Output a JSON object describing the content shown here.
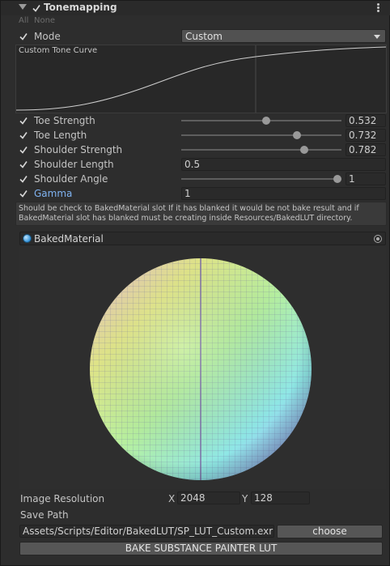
{
  "header": {
    "title": "Tonemapping",
    "all": "All",
    "none": "None"
  },
  "mode": {
    "label": "Mode",
    "value": "Custom"
  },
  "curve": {
    "title": "Custom Tone Curve"
  },
  "params": [
    {
      "label": "Toe Strength",
      "value": "0.532",
      "slider": 0.532
    },
    {
      "label": "Toe Length",
      "value": "0.732",
      "slider": 0.732
    },
    {
      "label": "Shoulder Strength",
      "value": "0.782",
      "slider": 0.782
    },
    {
      "label": "Shoulder Length",
      "value": "0.5"
    },
    {
      "label": "Shoulder Angle",
      "value": "1",
      "slider": 1.0
    },
    {
      "label": "Gamma",
      "value": "1"
    }
  ],
  "help": {
    "line1": "Should be check to BakedMaterial slot If it has blanked it would be not bake result and if",
    "line2": "BakedMaterial slot has blanked must be creating inside Resources/BakedLUT directory."
  },
  "baked_material": {
    "name": "BakedMaterial"
  },
  "resolution": {
    "label": "Image Resolution",
    "x_label": "X",
    "x_value": "2048",
    "y_label": "Y",
    "y_value": "128"
  },
  "save_path": {
    "label": "Save Path",
    "value": "Assets/Scripts/Editor/BakedLUT/SP_LUT_Custom.exr",
    "choose": "choose"
  },
  "bake_button": "BAKE SUBSTANCE PAINTER LUT",
  "colors": {
    "accent_blue": "#7fb2f0",
    "bg": "#2d2d2d",
    "field": "#2a2a2a",
    "button": "#565656"
  }
}
